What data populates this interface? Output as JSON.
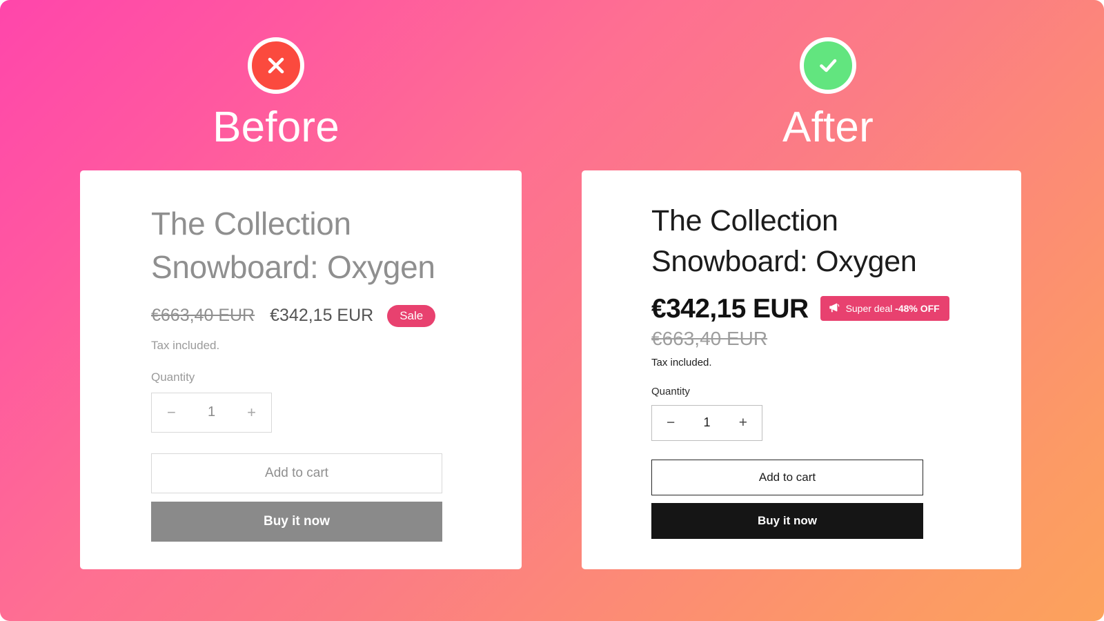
{
  "background": {
    "gradient_from": "#ff46ab",
    "gradient_to": "#fca25c"
  },
  "columns": [
    {
      "key": "before",
      "title": "Before",
      "status_icon": "x-circle-icon",
      "status_color": "#fb4a3e"
    },
    {
      "key": "after",
      "title": "After",
      "status_icon": "check-circle-icon",
      "status_color": "#62e57f"
    }
  ],
  "before_card": {
    "product_title": "The Collection Snowboard: Oxygen",
    "price_old": "€663,40 EUR",
    "price_new": "€342,15 EUR",
    "sale_badge": "Sale",
    "tax_note": "Tax included.",
    "quantity_label": "Quantity",
    "quantity_decrease": "−",
    "quantity_value": "1",
    "quantity_increase": "+",
    "add_to_cart_label": "Add to cart",
    "buy_now_label": "Buy it now",
    "accent_color": "#e8416f",
    "buy_button_color": "#8a8a8a"
  },
  "after_card": {
    "product_title": "The Collection Snowboard: Oxygen",
    "price_new": "€342,15 EUR",
    "price_old": "€663,40 EUR",
    "deal_badge_icon": "megaphone-icon",
    "deal_badge_text": "Super deal",
    "deal_badge_discount": "-48% OFF",
    "tax_note": "Tax included.",
    "quantity_label": "Quantity",
    "quantity_decrease": "−",
    "quantity_value": "1",
    "quantity_increase": "+",
    "add_to_cart_label": "Add to cart",
    "buy_now_label": "Buy it now",
    "accent_color": "#e8416f",
    "buy_button_color": "#151515"
  }
}
